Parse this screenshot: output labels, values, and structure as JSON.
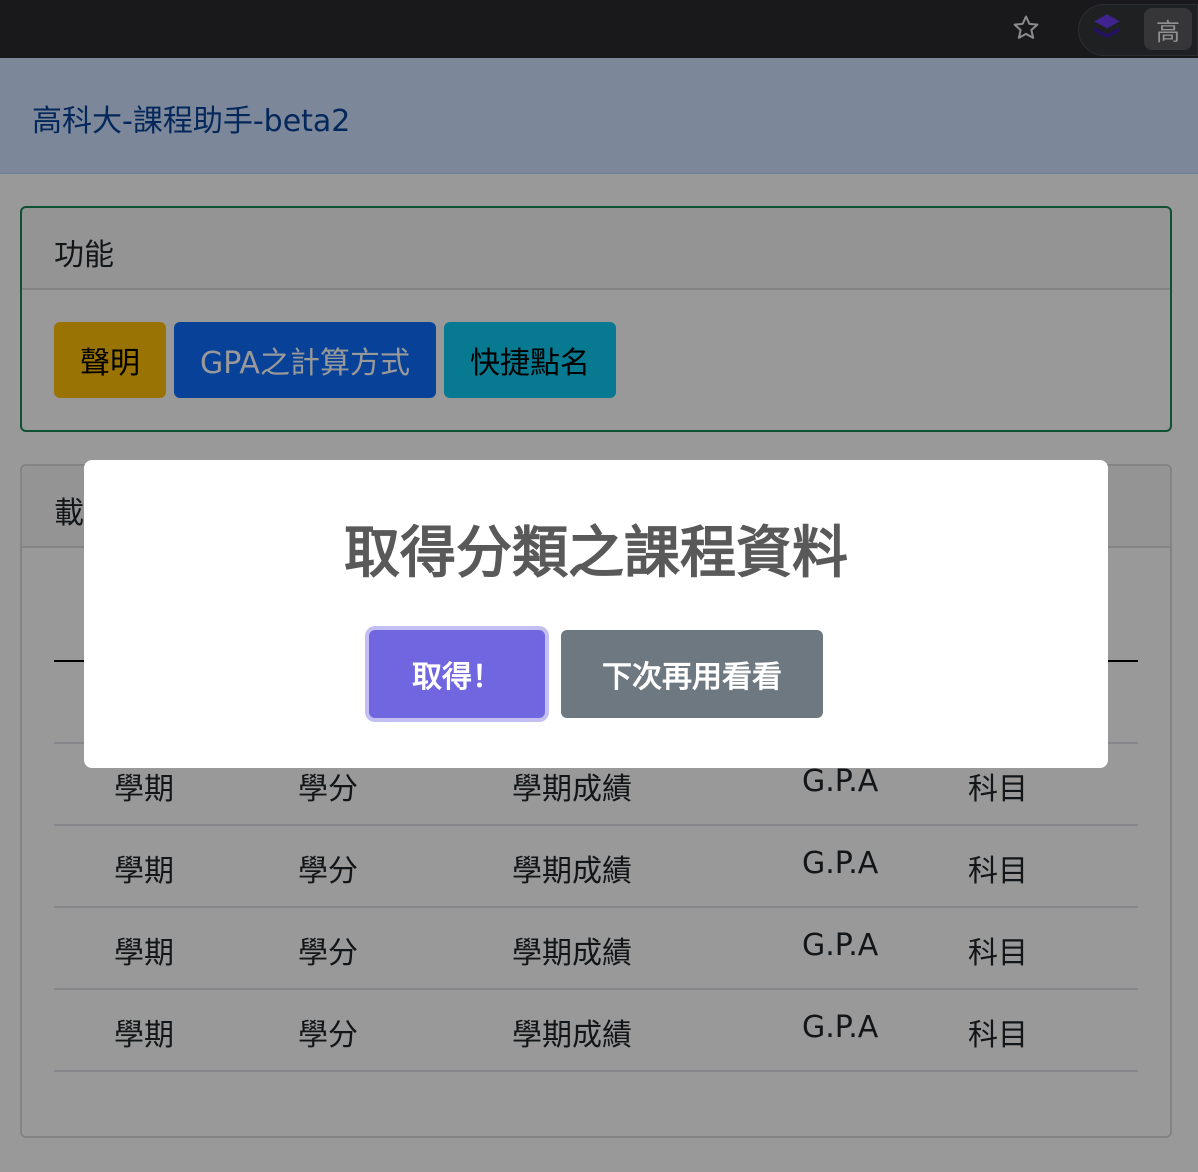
{
  "browser": {
    "avatar_label": "高"
  },
  "navbar": {
    "brand": "高科大-課程助手-beta2"
  },
  "function_card": {
    "header": "功能",
    "buttons": {
      "statement": "聲明",
      "gpa_method": "GPA之計算方式",
      "quick_rollcall": "快捷點名"
    }
  },
  "data_card": {
    "header_partial": "載"
  },
  "table": {
    "rows": [
      {
        "term": "",
        "credit": "",
        "score": "",
        "gpa": "",
        "subject": ""
      },
      {
        "term": "學期",
        "credit": "學分",
        "score": "學期成績",
        "gpa": "G.P.A",
        "subject": "科目"
      },
      {
        "term": "學期",
        "credit": "學分",
        "score": "學期成績",
        "gpa": "G.P.A",
        "subject": "科目"
      },
      {
        "term": "學期",
        "credit": "學分",
        "score": "學期成績",
        "gpa": "G.P.A",
        "subject": "科目"
      },
      {
        "term": "學期",
        "credit": "學分",
        "score": "學期成績",
        "gpa": "G.P.A",
        "subject": "科目"
      }
    ]
  },
  "modal": {
    "title": "取得分類之課程資料",
    "confirm_label": "取得！",
    "deny_label": "下次再用看看"
  },
  "icons": {
    "star": "star-outline-icon",
    "extension": "stack-icon"
  },
  "colors": {
    "navbar_bg": "#cfe2ff",
    "navbar_text": "#084298",
    "warning": "#ffc107",
    "primary": "#0d6efd",
    "info": "#0dcaf0",
    "card_success_border": "#198754",
    "confirm": "#7066e0",
    "deny": "#6e7881"
  }
}
